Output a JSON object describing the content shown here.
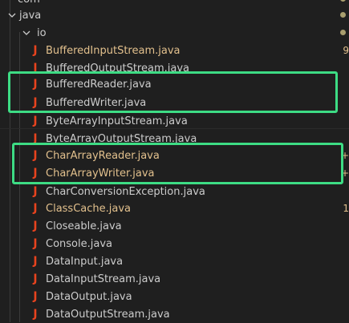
{
  "tree": {
    "parent_partial": "com",
    "java_folder": "java",
    "io_folder": "io",
    "files": [
      {
        "name": "BufferedInputStream.java",
        "status": "modified",
        "badge": "9"
      },
      {
        "name": "BufferedOutputStream.java",
        "status": "default",
        "badge": ""
      },
      {
        "name": "BufferedReader.java",
        "status": "default",
        "badge": ""
      },
      {
        "name": "BufferedWriter.java",
        "status": "default",
        "badge": ""
      },
      {
        "name": "ByteArrayInputStream.java",
        "status": "default",
        "badge": ""
      },
      {
        "name": "ByteArrayOutputStream.java",
        "status": "default",
        "badge": ""
      },
      {
        "name": "CharArrayReader.java",
        "status": "modified",
        "badge": "+"
      },
      {
        "name": "CharArrayWriter.java",
        "status": "modified",
        "badge": "+"
      },
      {
        "name": "CharConversionException.java",
        "status": "default",
        "badge": ""
      },
      {
        "name": "ClassCache.java",
        "status": "modified",
        "badge": "1"
      },
      {
        "name": "Closeable.java",
        "status": "default",
        "badge": ""
      },
      {
        "name": "Console.java",
        "status": "default",
        "badge": ""
      },
      {
        "name": "DataInput.java",
        "status": "default",
        "badge": ""
      },
      {
        "name": "DataInputStream.java",
        "status": "default",
        "badge": ""
      },
      {
        "name": "DataOutput.java",
        "status": "default",
        "badge": ""
      },
      {
        "name": "DataOutputStream.java",
        "status": "default",
        "badge": ""
      }
    ],
    "java_icon_glyph": "J"
  },
  "colors": {
    "background": "#1f1f1f",
    "highlight_box": "#3ddc84",
    "java_icon": "#e8431e",
    "modified_text": "#e2c08d",
    "default_text": "#cccccc"
  },
  "highlight_groups": [
    [
      "BufferedReader.java",
      "BufferedWriter.java"
    ],
    [
      "CharArrayReader.java",
      "CharArrayWriter.java"
    ]
  ]
}
